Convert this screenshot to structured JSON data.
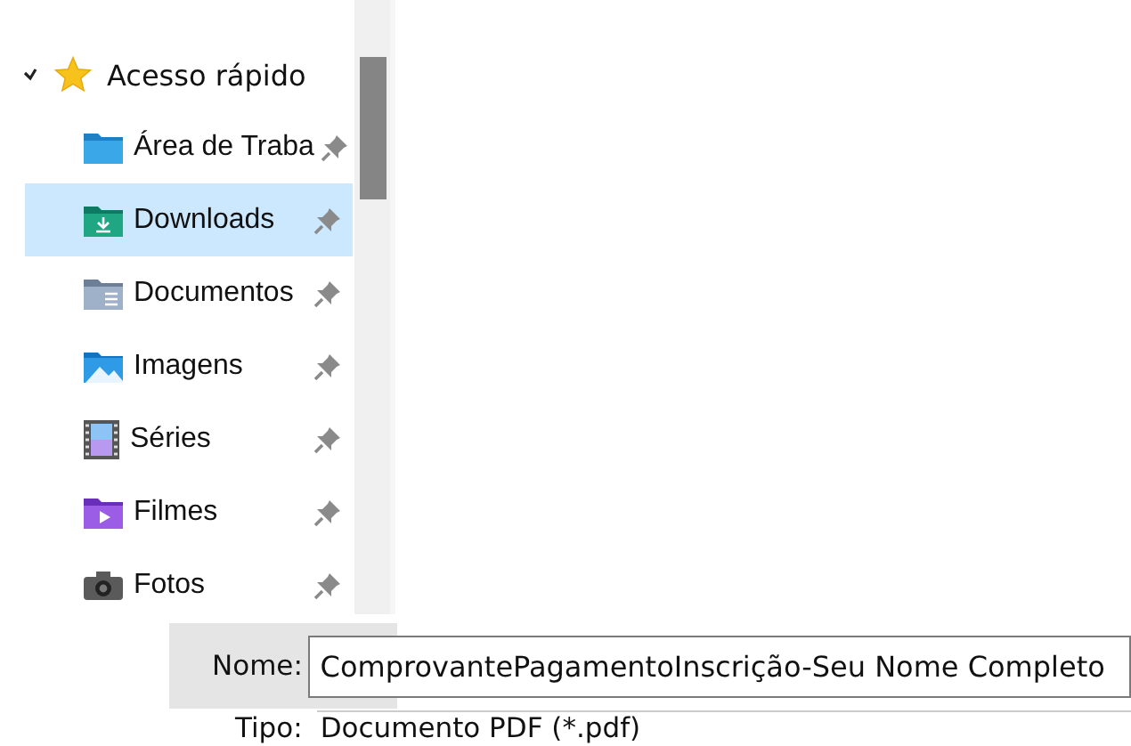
{
  "sidebar": {
    "header": {
      "label": "Acesso rápido",
      "expanded": true
    },
    "items": [
      {
        "label": "Área de Traba",
        "kind": "desktop",
        "pinned": true,
        "selected": false
      },
      {
        "label": "Downloads",
        "kind": "downloads",
        "pinned": true,
        "selected": true
      },
      {
        "label": "Documentos",
        "kind": "documents",
        "pinned": true,
        "selected": false
      },
      {
        "label": "Imagens",
        "kind": "pictures",
        "pinned": true,
        "selected": false
      },
      {
        "label": "Séries",
        "kind": "videos",
        "pinned": true,
        "selected": false
      },
      {
        "label": "Filmes",
        "kind": "movies",
        "pinned": true,
        "selected": false
      },
      {
        "label": "Fotos",
        "kind": "photos",
        "pinned": true,
        "selected": false
      }
    ]
  },
  "filename": {
    "label": "Nome:",
    "value": "ComprovantePagamentoInscrição-Seu Nome Completo"
  },
  "filetype": {
    "label": "Tipo:",
    "value": "Documento PDF (*.pdf)"
  }
}
